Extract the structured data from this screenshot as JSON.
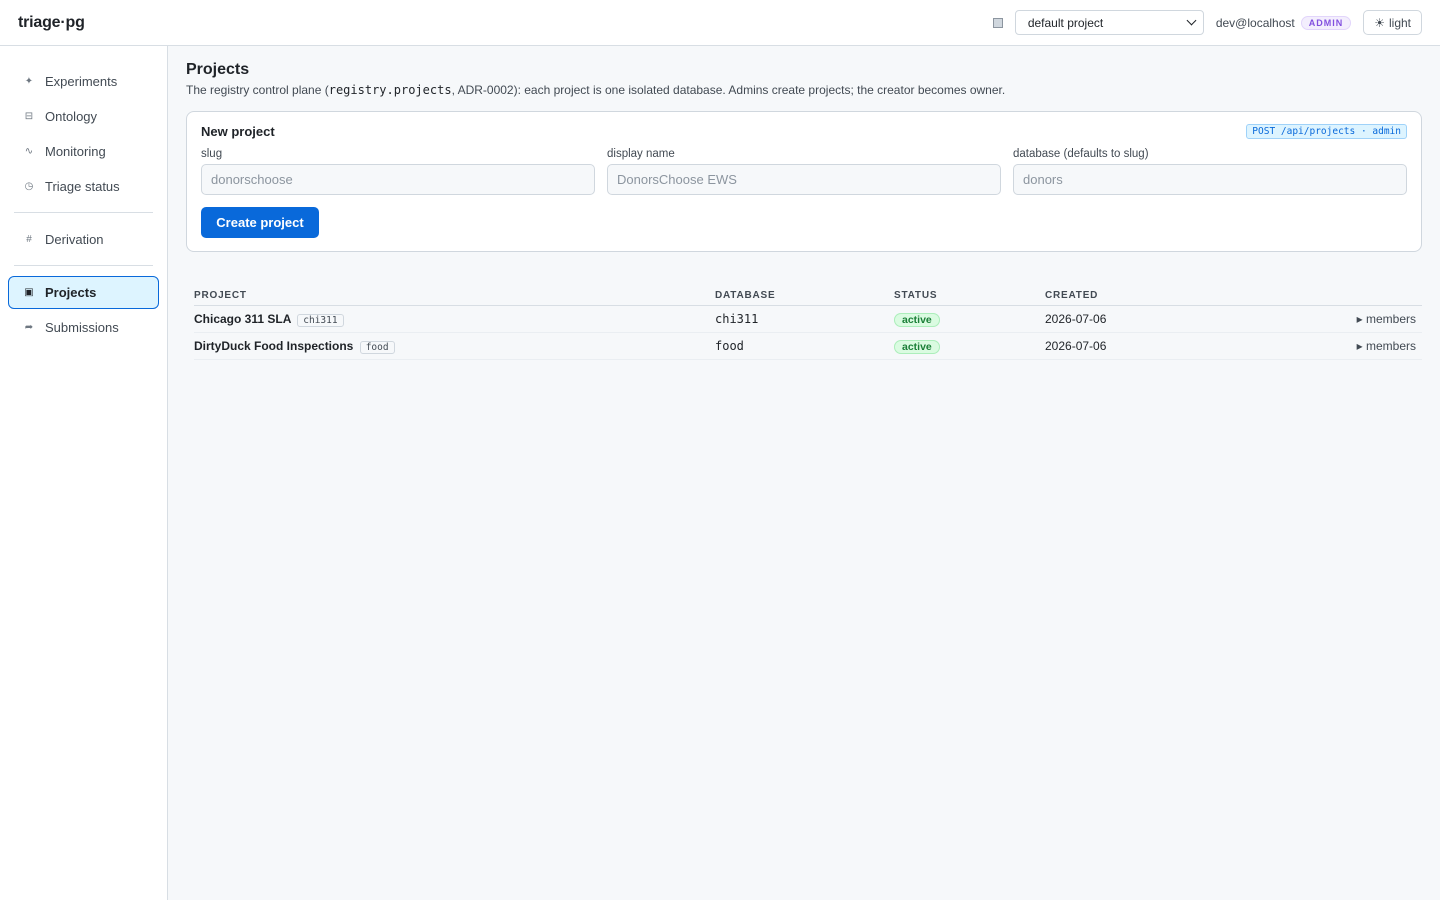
{
  "header": {
    "brand": "triage·pg",
    "project_select": "default project",
    "user": "dev@localhost",
    "role_badge": "ADMIN",
    "theme_toggle": "light",
    "theme_icon": "☀"
  },
  "sidebar": {
    "group1": [
      {
        "icon": "✦",
        "label": "Experiments"
      },
      {
        "icon": "⊟",
        "label": "Ontology"
      },
      {
        "icon": "∿",
        "label": "Monitoring"
      },
      {
        "icon": "◷",
        "label": "Triage status"
      }
    ],
    "group2": [
      {
        "icon": "#",
        "label": "Derivation"
      }
    ],
    "group3": [
      {
        "icon": "▣",
        "label": "Projects",
        "active": true
      },
      {
        "icon": "➦",
        "label": "Submissions"
      }
    ]
  },
  "main": {
    "title": "Projects",
    "desc_before": "The registry control plane (",
    "desc_code": "registry.projects",
    "desc_after": ", ADR-0002): each project is one isolated database. Admins create projects; the creator becomes owner.",
    "new_project": {
      "title": "New project",
      "endpoint": "POST /api/projects · admin",
      "fields": [
        {
          "label": "slug",
          "placeholder": "donorschoose"
        },
        {
          "label": "display name",
          "placeholder": "DonorsChoose EWS"
        },
        {
          "label": "database (defaults to slug)",
          "placeholder": "donors"
        }
      ],
      "submit_label": "Create project"
    },
    "table": {
      "columns": [
        "PROJECT",
        "DATABASE",
        "STATUS",
        "CREATED"
      ],
      "rows": [
        {
          "name": "Chicago 311 SLA",
          "slug": "chi311",
          "database": "chi311",
          "status": "active",
          "created": "2026-07-06",
          "action": "▸ members"
        },
        {
          "name": "DirtyDuck Food Inspections",
          "slug": "food",
          "database": "food",
          "status": "active",
          "created": "2026-07-06",
          "action": "▸ members"
        }
      ]
    }
  }
}
